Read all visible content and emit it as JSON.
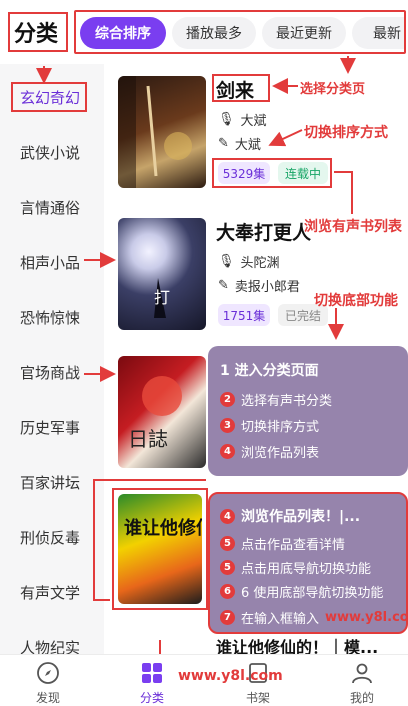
{
  "header": {
    "title": "分类",
    "sort_tabs": [
      "综合排序",
      "播放最多",
      "最近更新",
      "最新"
    ],
    "active_sort": "综合排序"
  },
  "sidebar": {
    "items": [
      "玄幻奇幻",
      "武侠小说",
      "言情通俗",
      "相声小品",
      "恐怖惊悚",
      "官场商战",
      "历史军事",
      "百家讲坛",
      "刑侦反毒",
      "有声文学",
      "人物纪实"
    ],
    "active": "玄幻奇幻"
  },
  "books": [
    {
      "title": "剑来",
      "author": "大斌",
      "narrator": "大斌",
      "count": "5329集",
      "status": "连载中"
    },
    {
      "title": "大奉打更人",
      "author": "头陀渊",
      "narrator": "卖报小郎君",
      "count": "1751集",
      "status": "已完结"
    },
    {
      "cover_text": "日誌"
    },
    {
      "cover_text": "谁让他修仙的"
    },
    {
      "title": "谁让他修仙的！｜模..."
    }
  ],
  "annotations": {
    "select_category": "选择分类页",
    "switch_sort": "切换排序方式",
    "browse_list": "浏览有声书列表",
    "switch_nav": "切换底部功能"
  },
  "overlay1": {
    "steps": [
      "1 进入分类页面",
      "选择有声书分类",
      "切换排序方式",
      "浏览作品列表"
    ],
    "nums": [
      "2",
      "3",
      "4"
    ]
  },
  "overlay2": {
    "steps": [
      "浏览作品列表！|...",
      "点击作品查看详情",
      "点击用底导航切换功能",
      "6 使用底部导航切换功能",
      "在输入框输入"
    ],
    "nums": [
      "4",
      "5",
      "5",
      "6",
      "7"
    ],
    "site": "www.y8l.com"
  },
  "bottom_nav": {
    "items": [
      "发现",
      "分类",
      "书架",
      "我的"
    ],
    "active": "分类"
  },
  "watermark": "www.y8l.com",
  "colors": {
    "accent": "#7a3ef0",
    "annotation": "#e23b3b"
  }
}
